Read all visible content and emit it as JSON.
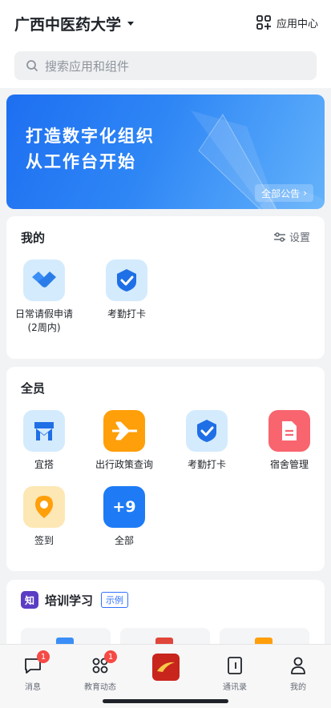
{
  "header": {
    "org_name": "广西中医药大学",
    "app_center_label": "应用中心"
  },
  "search": {
    "placeholder": "搜索应用和组件"
  },
  "banner": {
    "line1": "打造数字化组织",
    "line2": "从工作台开始",
    "all_announcements": "全部公告"
  },
  "mine": {
    "title": "我的",
    "settings_label": "设置",
    "apps": [
      {
        "label": "日常请假申请\n(2周内)",
        "icon": "handshake-icon"
      },
      {
        "label": "考勤打卡",
        "icon": "checkin-icon"
      }
    ]
  },
  "all_staff": {
    "title": "全员",
    "apps": [
      {
        "label": "宜搭",
        "icon": "yida-icon"
      },
      {
        "label": "出行政策查询",
        "icon": "airplane-icon"
      },
      {
        "label": "考勤打卡",
        "icon": "checkin-icon"
      },
      {
        "label": "宿舍管理",
        "icon": "document-icon"
      },
      {
        "label": "签到",
        "icon": "location-pin-icon"
      },
      {
        "label": "全部",
        "icon": "more-count-icon",
        "badge_text": "+9"
      }
    ]
  },
  "training": {
    "icon_text": "知",
    "title": "培训学习",
    "tag": "示例"
  },
  "tabbar": [
    {
      "label": "消息",
      "badge": "1"
    },
    {
      "label": "教育动态",
      "badge": "1"
    },
    {
      "label": ""
    },
    {
      "label": "通讯录"
    },
    {
      "label": "我的"
    }
  ],
  "colors": {
    "accent": "#3370ff",
    "badge": "#f54a45",
    "banner_start": "#1e6ff1",
    "banner_end": "#63b2fb"
  }
}
